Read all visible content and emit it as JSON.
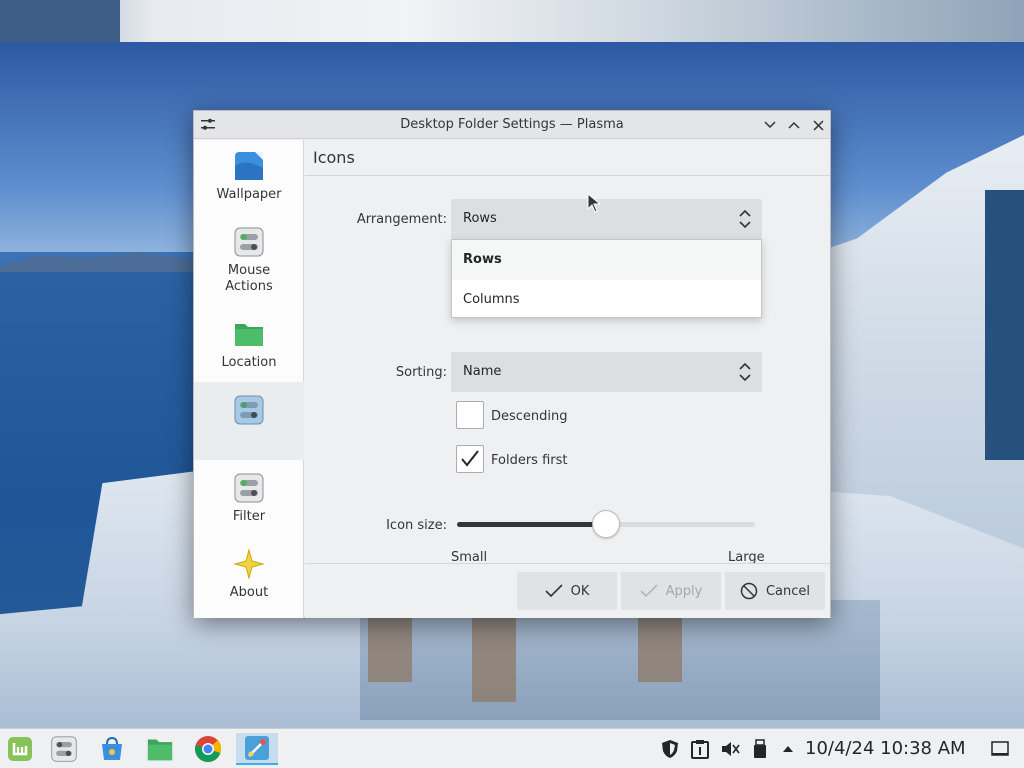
{
  "window": {
    "title": "Desktop Folder Settings — Plasma",
    "controls": {
      "minimize": "chevron-down-icon",
      "maximize": "chevron-up-icon",
      "close": "close-icon"
    }
  },
  "sidebar": {
    "items": [
      {
        "label": "Wallpaper",
        "icon": "wallpaper-icon"
      },
      {
        "label": "Mouse Actions",
        "icon": "toggle-icon"
      },
      {
        "label": "Location",
        "icon": "folder-icon"
      },
      {
        "label": "",
        "icon": "toggle-icon",
        "active": true
      },
      {
        "label": "Filter",
        "icon": "toggle-icon"
      },
      {
        "label": "About",
        "icon": "star-icon"
      }
    ]
  },
  "page": {
    "title": "Icons"
  },
  "form": {
    "arrangement": {
      "label": "Arrangement:",
      "value": "Rows",
      "options": [
        "Rows",
        "Columns"
      ],
      "selected_option": "Rows"
    },
    "sorting": {
      "label": "Sorting:",
      "value": "Name"
    },
    "descending": {
      "label": "Descending",
      "checked": false
    },
    "folders_first": {
      "label": "Folders first",
      "checked": true
    },
    "icon_size": {
      "label": "Icon size:",
      "min_label": "Small",
      "max_label": "Large",
      "level": 0.5
    }
  },
  "buttons": {
    "ok": "OK",
    "apply": "Apply",
    "cancel": "Cancel"
  },
  "taskbar": {
    "launchers": [
      "mint-menu-icon",
      "toggle-icon",
      "store-icon",
      "folder-icon",
      "chrome-icon",
      "settings-app-icon"
    ],
    "tray": [
      "shield-icon",
      "clipboard-icon",
      "volume-muted-icon",
      "usb-icon",
      "expand-up-icon"
    ],
    "clock": "10/4/24 10:38 AM",
    "show_desktop": "show-desktop-icon"
  },
  "colors": {
    "accent": "#3daee9",
    "window_bg": "#eff0f1",
    "sidebar_bg": "#fcfcfc",
    "combo_bg": "#dcdedf"
  }
}
